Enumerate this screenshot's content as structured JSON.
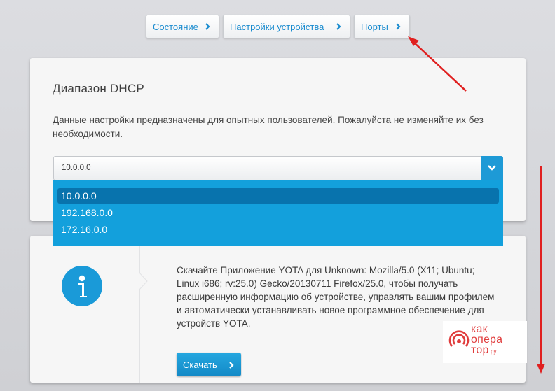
{
  "tabs": [
    {
      "label": "Состояние"
    },
    {
      "label": "Настройки устройства"
    },
    {
      "label": "Порты"
    }
  ],
  "dhcp": {
    "title": "Диапазон DHCP",
    "description": "Данные настройки предназначены для опытных пользователей. Пожалуйста не изменяйте их без необходимости.",
    "selected_value": "10.0.0.0",
    "options": [
      "10.0.0.0",
      "192.168.0.0",
      "172.16.0.0"
    ]
  },
  "promo": {
    "text": "Скачайте Приложение YOTA для Unknown: Mozilla/5.0 (X11; Ubuntu; Linux i686; rv:25.0) Gecko/20130711 Firefox/25.0, чтобы получать расширенную информацию об устройстве, управлять вашим профилем и автоматически устанавливать новое программное обеспечение для устройств YOTA.",
    "download_label": "Скачать"
  },
  "watermark": {
    "line1": "как",
    "line2": "опера",
    "line3": "тор",
    "suffix": ".ру"
  },
  "colors": {
    "accent": "#1a9ad8",
    "dropdown_bg": "#13a0dc",
    "dropdown_selected": "#0873ad",
    "annotation_arrow": "#e02020"
  },
  "icons": [
    "chevron-right-icon",
    "chevron-down-icon",
    "info-icon",
    "operator-logo-icon"
  ]
}
